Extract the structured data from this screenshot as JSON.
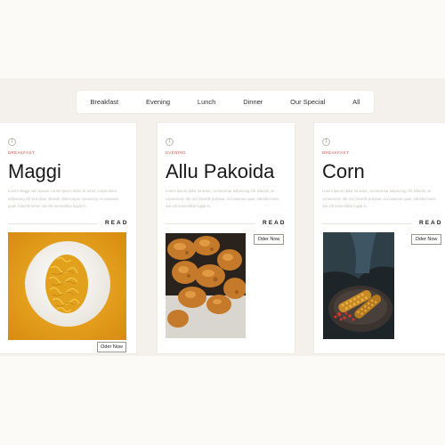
{
  "filters": [
    "Breakfast",
    "Evening",
    "Lunch",
    "Dinner",
    "Our Special",
    "All"
  ],
  "cards": [
    {
      "circle": "1",
      "category": "BREAKFAST",
      "title": "Maggi",
      "text": "Lorem Maggi ndo usuam Lorem ipsum dolor sit amet, consectetur adipiscing elit sed diam. Blandit ullamcorper nonummy. Accusamus quas, lobortis lorem nisi elit nonmollitia fugiat in.",
      "read": "READ",
      "order": "Oder Now"
    },
    {
      "circle": "1",
      "category": "EVENING",
      "title": "Allu Pakoida",
      "text": "Lorem ipsum dolor sit amet, consectetur adipiscing elit. Blandit, at consectetur tibi orci lobortis pulvinar. Accusamus quas, lobortis lorem nisi elit nonmollitia fugiat in.",
      "read": "READ",
      "order": "Oder Now"
    },
    {
      "circle": "1",
      "category": "BREAKFAST",
      "title": "Corn",
      "text": "Lorem ipsum dolor sit amet, consectetur adipiscing elit. Blandit, at consectetur tibi orci lobortis pulvinar. Accusamus quas, lobortis lorem nisi elit nonmollitia fugiat in.",
      "read": "READ",
      "order": "Oder Now"
    }
  ],
  "colors": {
    "accent": "#e0524a",
    "page_background": "#fcfaf7",
    "band_background": "#f4f1ec"
  }
}
